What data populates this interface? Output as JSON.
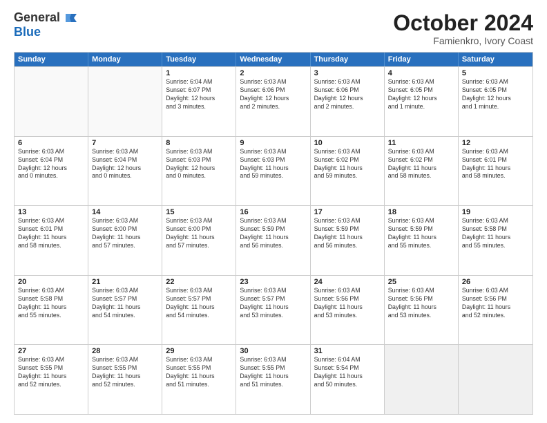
{
  "header": {
    "logo_general": "General",
    "logo_blue": "Blue",
    "month_year": "October 2024",
    "location": "Famienkro, Ivory Coast"
  },
  "days_of_week": [
    "Sunday",
    "Monday",
    "Tuesday",
    "Wednesday",
    "Thursday",
    "Friday",
    "Saturday"
  ],
  "weeks": [
    [
      {
        "day": "",
        "text": "",
        "empty": true
      },
      {
        "day": "",
        "text": "",
        "empty": true
      },
      {
        "day": "1",
        "text": "Sunrise: 6:04 AM\nSunset: 6:07 PM\nDaylight: 12 hours\nand 3 minutes.",
        "empty": false
      },
      {
        "day": "2",
        "text": "Sunrise: 6:03 AM\nSunset: 6:06 PM\nDaylight: 12 hours\nand 2 minutes.",
        "empty": false
      },
      {
        "day": "3",
        "text": "Sunrise: 6:03 AM\nSunset: 6:06 PM\nDaylight: 12 hours\nand 2 minutes.",
        "empty": false
      },
      {
        "day": "4",
        "text": "Sunrise: 6:03 AM\nSunset: 6:05 PM\nDaylight: 12 hours\nand 1 minute.",
        "empty": false
      },
      {
        "day": "5",
        "text": "Sunrise: 6:03 AM\nSunset: 6:05 PM\nDaylight: 12 hours\nand 1 minute.",
        "empty": false
      }
    ],
    [
      {
        "day": "6",
        "text": "Sunrise: 6:03 AM\nSunset: 6:04 PM\nDaylight: 12 hours\nand 0 minutes.",
        "empty": false
      },
      {
        "day": "7",
        "text": "Sunrise: 6:03 AM\nSunset: 6:04 PM\nDaylight: 12 hours\nand 0 minutes.",
        "empty": false
      },
      {
        "day": "8",
        "text": "Sunrise: 6:03 AM\nSunset: 6:03 PM\nDaylight: 12 hours\nand 0 minutes.",
        "empty": false
      },
      {
        "day": "9",
        "text": "Sunrise: 6:03 AM\nSunset: 6:03 PM\nDaylight: 11 hours\nand 59 minutes.",
        "empty": false
      },
      {
        "day": "10",
        "text": "Sunrise: 6:03 AM\nSunset: 6:02 PM\nDaylight: 11 hours\nand 59 minutes.",
        "empty": false
      },
      {
        "day": "11",
        "text": "Sunrise: 6:03 AM\nSunset: 6:02 PM\nDaylight: 11 hours\nand 58 minutes.",
        "empty": false
      },
      {
        "day": "12",
        "text": "Sunrise: 6:03 AM\nSunset: 6:01 PM\nDaylight: 11 hours\nand 58 minutes.",
        "empty": false
      }
    ],
    [
      {
        "day": "13",
        "text": "Sunrise: 6:03 AM\nSunset: 6:01 PM\nDaylight: 11 hours\nand 58 minutes.",
        "empty": false
      },
      {
        "day": "14",
        "text": "Sunrise: 6:03 AM\nSunset: 6:00 PM\nDaylight: 11 hours\nand 57 minutes.",
        "empty": false
      },
      {
        "day": "15",
        "text": "Sunrise: 6:03 AM\nSunset: 6:00 PM\nDaylight: 11 hours\nand 57 minutes.",
        "empty": false
      },
      {
        "day": "16",
        "text": "Sunrise: 6:03 AM\nSunset: 5:59 PM\nDaylight: 11 hours\nand 56 minutes.",
        "empty": false
      },
      {
        "day": "17",
        "text": "Sunrise: 6:03 AM\nSunset: 5:59 PM\nDaylight: 11 hours\nand 56 minutes.",
        "empty": false
      },
      {
        "day": "18",
        "text": "Sunrise: 6:03 AM\nSunset: 5:59 PM\nDaylight: 11 hours\nand 55 minutes.",
        "empty": false
      },
      {
        "day": "19",
        "text": "Sunrise: 6:03 AM\nSunset: 5:58 PM\nDaylight: 11 hours\nand 55 minutes.",
        "empty": false
      }
    ],
    [
      {
        "day": "20",
        "text": "Sunrise: 6:03 AM\nSunset: 5:58 PM\nDaylight: 11 hours\nand 55 minutes.",
        "empty": false
      },
      {
        "day": "21",
        "text": "Sunrise: 6:03 AM\nSunset: 5:57 PM\nDaylight: 11 hours\nand 54 minutes.",
        "empty": false
      },
      {
        "day": "22",
        "text": "Sunrise: 6:03 AM\nSunset: 5:57 PM\nDaylight: 11 hours\nand 54 minutes.",
        "empty": false
      },
      {
        "day": "23",
        "text": "Sunrise: 6:03 AM\nSunset: 5:57 PM\nDaylight: 11 hours\nand 53 minutes.",
        "empty": false
      },
      {
        "day": "24",
        "text": "Sunrise: 6:03 AM\nSunset: 5:56 PM\nDaylight: 11 hours\nand 53 minutes.",
        "empty": false
      },
      {
        "day": "25",
        "text": "Sunrise: 6:03 AM\nSunset: 5:56 PM\nDaylight: 11 hours\nand 53 minutes.",
        "empty": false
      },
      {
        "day": "26",
        "text": "Sunrise: 6:03 AM\nSunset: 5:56 PM\nDaylight: 11 hours\nand 52 minutes.",
        "empty": false
      }
    ],
    [
      {
        "day": "27",
        "text": "Sunrise: 6:03 AM\nSunset: 5:55 PM\nDaylight: 11 hours\nand 52 minutes.",
        "empty": false
      },
      {
        "day": "28",
        "text": "Sunrise: 6:03 AM\nSunset: 5:55 PM\nDaylight: 11 hours\nand 52 minutes.",
        "empty": false
      },
      {
        "day": "29",
        "text": "Sunrise: 6:03 AM\nSunset: 5:55 PM\nDaylight: 11 hours\nand 51 minutes.",
        "empty": false
      },
      {
        "day": "30",
        "text": "Sunrise: 6:03 AM\nSunset: 5:55 PM\nDaylight: 11 hours\nand 51 minutes.",
        "empty": false
      },
      {
        "day": "31",
        "text": "Sunrise: 6:04 AM\nSunset: 5:54 PM\nDaylight: 11 hours\nand 50 minutes.",
        "empty": false
      },
      {
        "day": "",
        "text": "",
        "empty": true,
        "shaded": true
      },
      {
        "day": "",
        "text": "",
        "empty": true,
        "shaded": true
      }
    ]
  ]
}
